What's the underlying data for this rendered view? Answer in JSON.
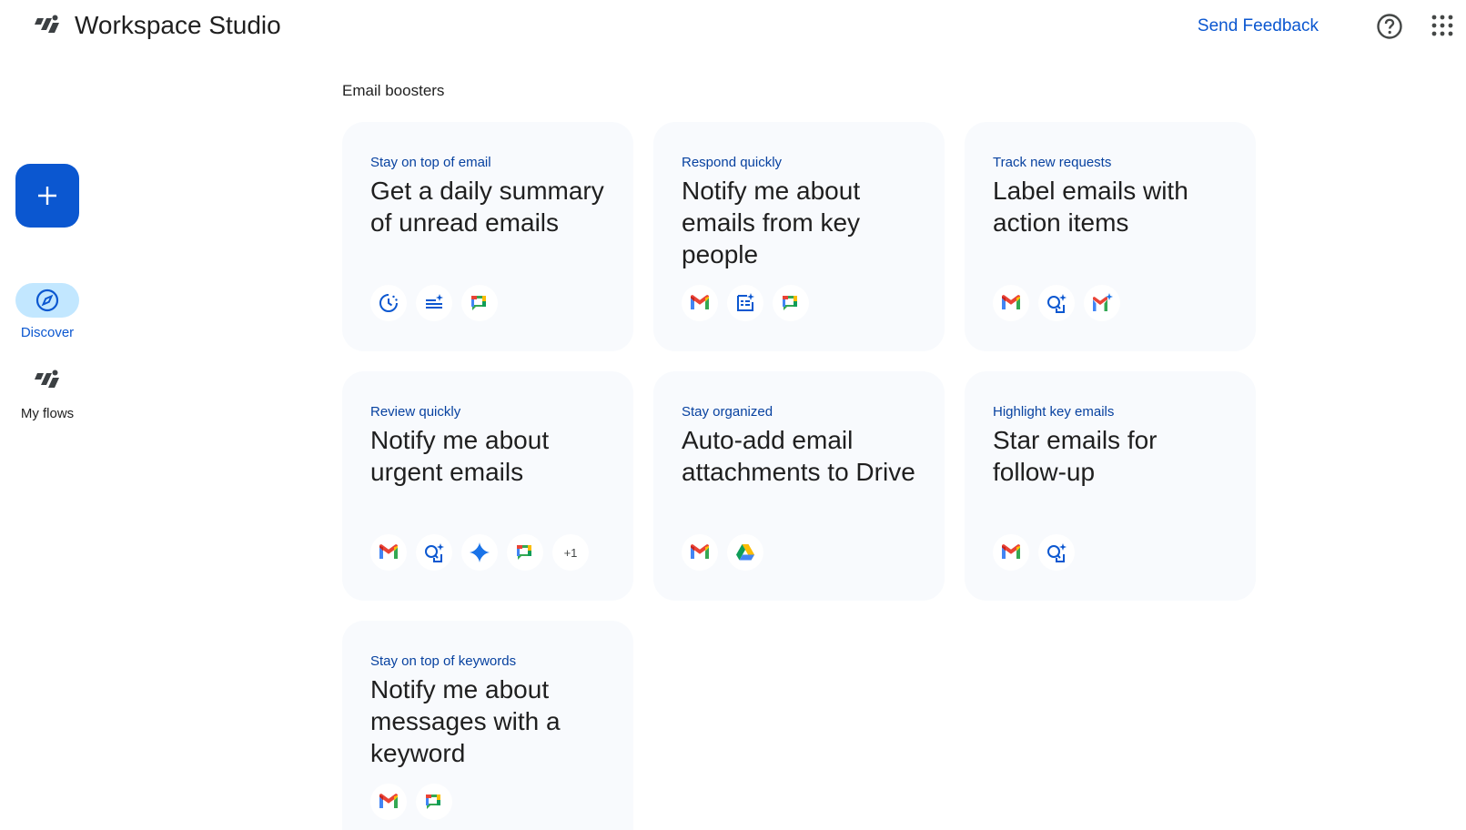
{
  "header": {
    "app_title": "Workspace Studio",
    "feedback_label": "Send Feedback",
    "icons": [
      "flows-logo-icon",
      "help-icon",
      "apps-grid-icon"
    ]
  },
  "sidebar": {
    "create_icon": "plus-icon",
    "items": [
      {
        "label": "Discover",
        "icon": "compass-icon",
        "active": true
      },
      {
        "label": "My flows",
        "icon": "flows-icon",
        "active": false
      }
    ]
  },
  "main": {
    "section_title": "Email boosters",
    "cards": [
      {
        "subtitle": "Stay on top of email",
        "title": "Get a daily summary of unread emails",
        "icons": [
          "schedule-icon",
          "summarize-icon",
          "chat-icon"
        ]
      },
      {
        "subtitle": "Respond quickly",
        "title": "Notify me about emails from key people",
        "icons": [
          "gmail-icon",
          "extract-icon",
          "chat-icon"
        ]
      },
      {
        "subtitle": "Track new requests",
        "title": "Label emails with action items",
        "icons": [
          "gmail-icon",
          "ai-search-icon",
          "gmail-ai-icon"
        ]
      },
      {
        "subtitle": "Review quickly",
        "title": "Notify me about urgent emails",
        "icons": [
          "gmail-icon",
          "ai-search-icon",
          "gemini-icon",
          "chat-icon"
        ],
        "more": "+1"
      },
      {
        "subtitle": "Stay organized",
        "title": "Auto-add email attachments to Drive",
        "icons": [
          "gmail-icon",
          "drive-icon"
        ]
      },
      {
        "subtitle": "Highlight key emails",
        "title": "Star emails for follow-up",
        "icons": [
          "gmail-icon",
          "ai-search-icon"
        ]
      },
      {
        "subtitle": "Stay on top of keywords",
        "title": "Notify me about messages with a keyword",
        "icons": [
          "gmail-icon",
          "chat-icon"
        ]
      }
    ]
  },
  "colors": {
    "primary": "#0b57d0",
    "card_bg": "#f8fafd",
    "nav_active": "#c2e7ff"
  }
}
